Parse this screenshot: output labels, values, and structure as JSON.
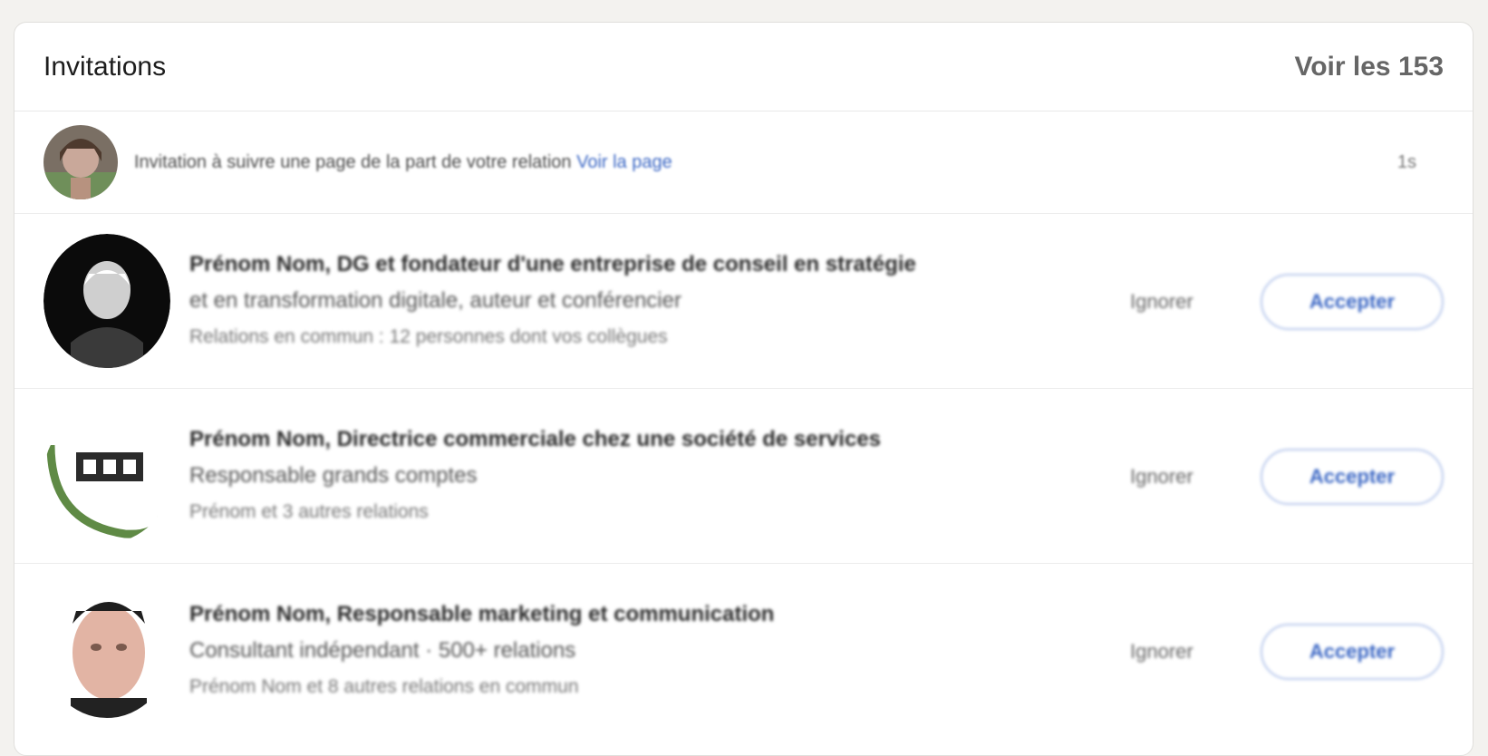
{
  "header": {
    "title": "Invitations",
    "see_all": "Voir les 153"
  },
  "notice": {
    "text": "Invitation à suivre une page de la part de votre relation",
    "link": "Voir la page",
    "time": "1s"
  },
  "invitations": [
    {
      "name": "Prénom Nom, DG et fondateur d'une entreprise de conseil en stratégie",
      "subtitle": "et en transformation digitale, auteur et conférencier",
      "mutual": "Relations en commun : 12 personnes dont vos collègues",
      "ignore_label": "Ignorer",
      "accept_label": "Accepter"
    },
    {
      "name": "Prénom Nom, Directrice commerciale chez une société de services",
      "subtitle": "Responsable grands comptes",
      "mutual": "Prénom et 3 autres relations",
      "ignore_label": "Ignorer",
      "accept_label": "Accepter"
    },
    {
      "name": "Prénom Nom, Responsable marketing et communication",
      "subtitle": "Consultant indépendant · 500+ relations",
      "mutual": "Prénom Nom et 8 autres relations en commun",
      "ignore_label": "Ignorer",
      "accept_label": "Accepter"
    }
  ]
}
